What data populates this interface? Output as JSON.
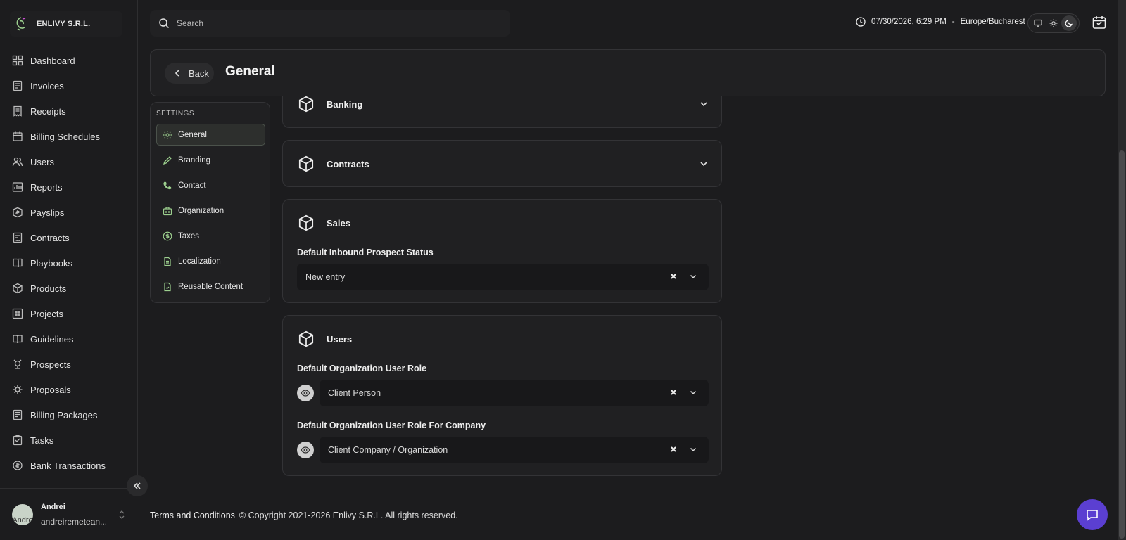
{
  "brand": {
    "name": "ENLIVY S.R.L."
  },
  "sidebar": {
    "items": [
      {
        "label": "Dashboard",
        "icon": "dashboard-icon"
      },
      {
        "label": "Invoices",
        "icon": "invoice-icon"
      },
      {
        "label": "Receipts",
        "icon": "receipt-icon"
      },
      {
        "label": "Billing Schedules",
        "icon": "schedule-icon"
      },
      {
        "label": "Users",
        "icon": "users-icon"
      },
      {
        "label": "Reports",
        "icon": "reports-icon"
      },
      {
        "label": "Payslips",
        "icon": "payslip-icon"
      },
      {
        "label": "Contracts",
        "icon": "contract-icon"
      },
      {
        "label": "Playbooks",
        "icon": "playbook-icon"
      },
      {
        "label": "Products",
        "icon": "product-icon"
      },
      {
        "label": "Projects",
        "icon": "project-icon"
      },
      {
        "label": "Guidelines",
        "icon": "guideline-icon"
      },
      {
        "label": "Prospects",
        "icon": "prospect-icon"
      },
      {
        "label": "Proposals",
        "icon": "proposal-icon"
      },
      {
        "label": "Billing Packages",
        "icon": "package-icon"
      },
      {
        "label": "Tasks",
        "icon": "task-icon"
      },
      {
        "label": "Bank Transactions",
        "icon": "bank-icon"
      }
    ],
    "user": {
      "name": "Andrei",
      "email": "andreiremetean...",
      "avatar_text": "Andre"
    }
  },
  "topbar": {
    "search_placeholder": "Search",
    "datetime": "07/30/2026, 6:29 PM",
    "separator": "-",
    "timezone": "Europe/Bucharest",
    "theme_mode": "dark"
  },
  "header": {
    "back_label": "Back",
    "title": "General"
  },
  "settings": {
    "label": "SETTINGS",
    "items": [
      {
        "label": "General",
        "icon": "gear-icon",
        "active": true
      },
      {
        "label": "Branding",
        "icon": "pencil-icon"
      },
      {
        "label": "Contact",
        "icon": "phone-icon"
      },
      {
        "label": "Organization",
        "icon": "building-icon"
      },
      {
        "label": "Taxes",
        "icon": "dollar-icon"
      },
      {
        "label": "Localization",
        "icon": "document-icon"
      },
      {
        "label": "Reusable Content",
        "icon": "reusable-doc-icon"
      }
    ]
  },
  "sections": {
    "banking": {
      "title": "Banking"
    },
    "contracts": {
      "title": "Contracts"
    },
    "sales": {
      "title": "Sales",
      "field_label": "Default Inbound Prospect Status",
      "field_value": "New entry"
    },
    "users": {
      "title": "Users",
      "role_label": "Default Organization User Role",
      "role_value": "Client Person",
      "company_role_label": "Default Organization User Role For Company",
      "company_role_value": "Client Company / Organization"
    }
  },
  "footer": {
    "terms": "Terms and Conditions",
    "copyright": "© Copyright 2021-2026 Enlivy S.R.L. All rights reserved."
  },
  "colors": {
    "accent_green": "#9ccf8e",
    "chat_purple": "#5b3fd1"
  }
}
